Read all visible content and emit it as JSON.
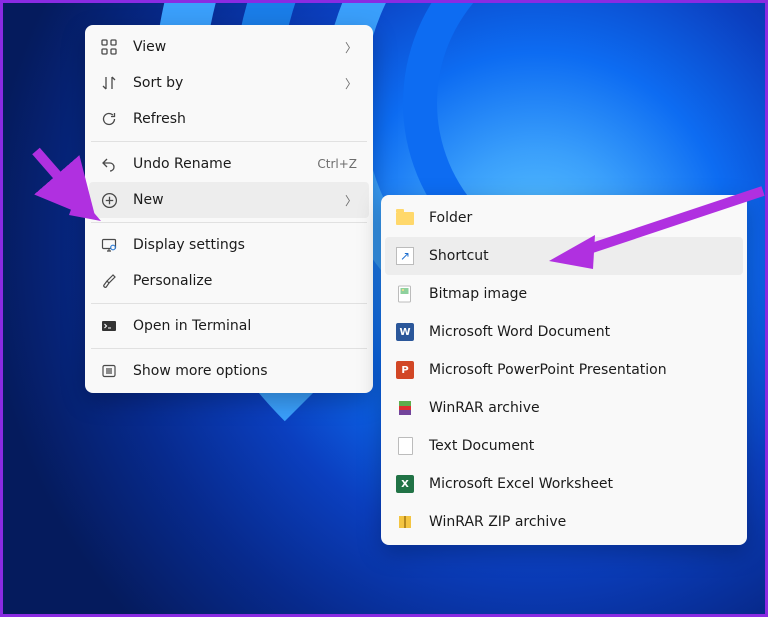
{
  "primary_menu": {
    "items": [
      {
        "icon": "grid-icon",
        "label": "View",
        "has_submenu": true
      },
      {
        "icon": "sort-icon",
        "label": "Sort by",
        "has_submenu": true
      },
      {
        "icon": "refresh-icon",
        "label": "Refresh"
      }
    ],
    "group2": [
      {
        "icon": "undo-icon",
        "label": "Undo Rename",
        "accel": "Ctrl+Z"
      },
      {
        "icon": "plus-circle-icon",
        "label": "New",
        "has_submenu": true,
        "highlighted": true
      }
    ],
    "group3": [
      {
        "icon": "display-icon",
        "label": "Display settings"
      },
      {
        "icon": "brush-icon",
        "label": "Personalize"
      }
    ],
    "group4": [
      {
        "icon": "terminal-icon",
        "label": "Open in Terminal"
      }
    ],
    "group5": [
      {
        "icon": "more-icon",
        "label": "Show more options"
      }
    ]
  },
  "submenu": {
    "items": [
      {
        "icon": "folder-icon",
        "label": "Folder"
      },
      {
        "icon": "shortcut-icon",
        "label": "Shortcut",
        "highlighted": true
      },
      {
        "icon": "bitmap-icon",
        "label": "Bitmap image"
      },
      {
        "icon": "word-icon",
        "label": "Microsoft Word Document"
      },
      {
        "icon": "powerpoint-icon",
        "label": "Microsoft PowerPoint Presentation"
      },
      {
        "icon": "winrar-icon",
        "label": "WinRAR archive"
      },
      {
        "icon": "text-icon",
        "label": "Text Document"
      },
      {
        "icon": "excel-icon",
        "label": "Microsoft Excel Worksheet"
      },
      {
        "icon": "winrar-zip-icon",
        "label": "WinRAR ZIP archive"
      }
    ]
  },
  "annotation_color": "#b030e0"
}
